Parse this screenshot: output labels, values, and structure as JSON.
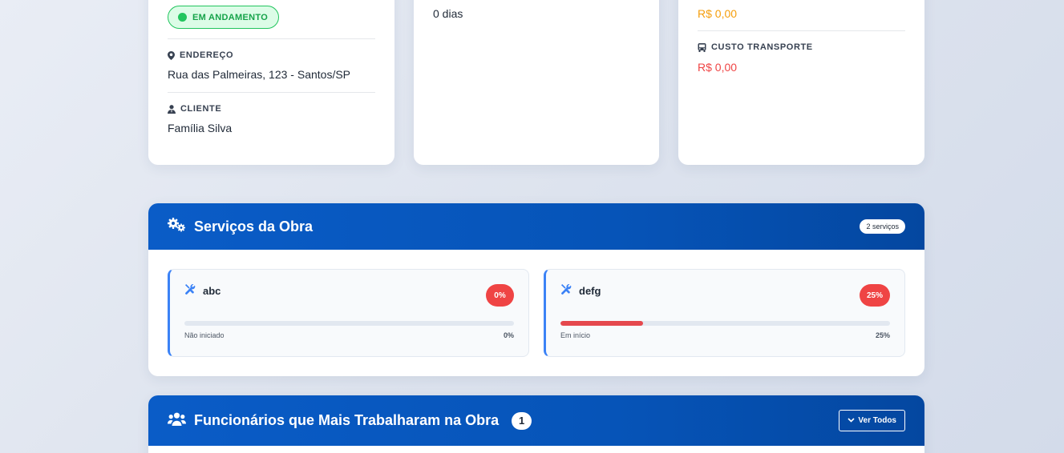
{
  "project_info": {
    "status": "EM ANDAMENTO",
    "address_label": "ENDEREÇO",
    "address": "Rua das Palmeiras, 123 - Santos/SP",
    "client_label": "CLIENTE",
    "client": "Família Silva"
  },
  "duration": {
    "value": "0 dias"
  },
  "costs": {
    "value_top": "R$ 0,00",
    "transport_label": "CUSTO TRANSPORTE",
    "transport_value": "R$ 0,00"
  },
  "services_section": {
    "title": "Serviços da Obra",
    "count_badge": "2 serviços",
    "items": [
      {
        "name": "abc",
        "percent_badge": "0%",
        "status": "Não iniciado",
        "percent_text": "0%",
        "progress": 0
      },
      {
        "name": "defg",
        "percent_badge": "25%",
        "status": "Em início",
        "percent_text": "25%",
        "progress": 25
      }
    ]
  },
  "workers_section": {
    "title": "Funcionários que Mais Trabalharam na Obra",
    "count": "1",
    "view_all_label": "Ver Todos"
  },
  "colors": {
    "accent_blue": "#0654b8",
    "status_green": "#22c55e",
    "warning_orange": "#f59e0b",
    "danger_red": "#ef4444"
  },
  "icons": {
    "address": "map-marker-icon",
    "client": "user-tie-icon",
    "transport": "bus-icon",
    "services": "gears-icon",
    "service_item": "tools-icon",
    "workers": "users-icon",
    "view_all": "chevron-down-icon"
  }
}
